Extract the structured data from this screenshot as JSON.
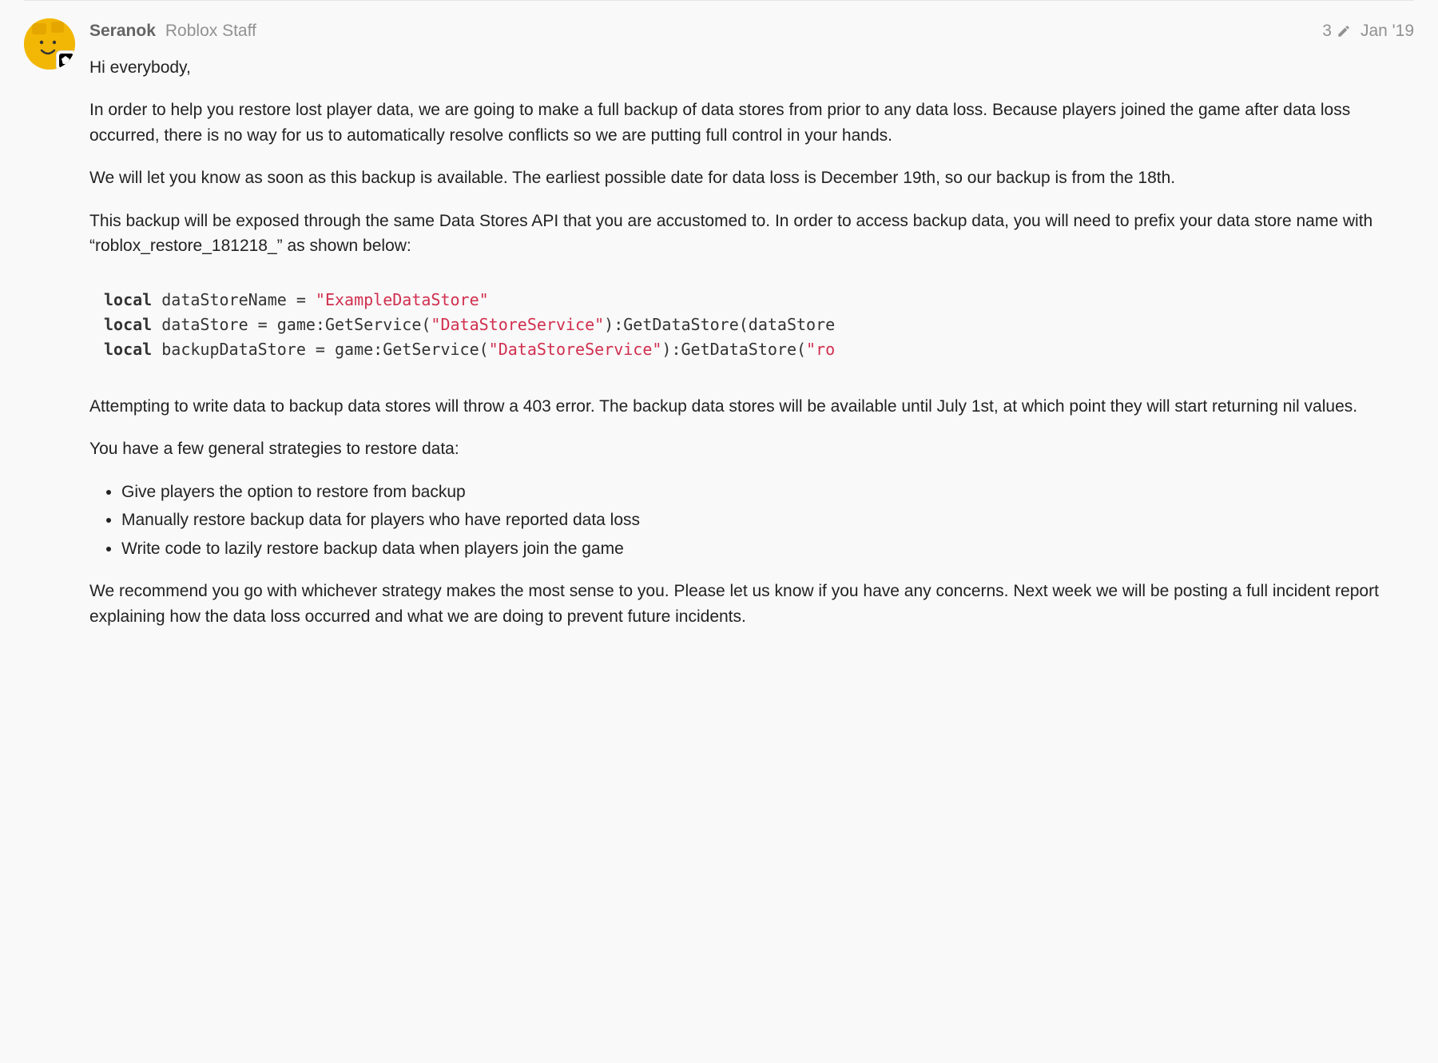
{
  "post": {
    "author": "Seranok",
    "role": "Roblox Staff",
    "edit_count": "3",
    "date": "Jan '19",
    "paragraphs": {
      "p1": "Hi everybody,",
      "p2": "In order to help you restore lost player data, we are going to make a full backup of data stores from prior to any data loss. Because players joined the game after data loss occurred, there is no way for us to automatically resolve conflicts so we are putting full control in your hands.",
      "p3": "We will let you know as soon as this backup is available. The earliest possible date for data loss is December 19th, so our backup is from the 18th.",
      "p4": "This backup will be exposed through the same Data Stores API that you are accustomed to. In order to access backup data, you will need to prefix your data store name with “roblox_restore_181218_” as shown below:",
      "p5": "Attempting to write data to backup data stores will throw a 403 error. The backup data stores will be available until July 1st, at which point they will start returning nil values.",
      "p6": "You have a few general strategies to restore data:",
      "p7": "We recommend you go with whichever strategy makes the most sense to you. Please let us know if you have any concerns. Next week we will be posting a full incident report explaining how the data loss occurred and what we are doing to prevent future incidents."
    },
    "code": {
      "kw_local": "local",
      "l1_ident": " dataStoreName = ",
      "l1_str": "\"ExampleDataStore\"",
      "l2_ident": " dataStore = game:GetService(",
      "l2_str": "\"DataStoreService\"",
      "l2_tail": "):GetDataStore(dataStore",
      "l3_ident": " backupDataStore = game:GetService(",
      "l3_str": "\"DataStoreService\"",
      "l3_tail": "):GetDataStore(",
      "l3_str2": "\"ro"
    },
    "strategies": [
      "Give players the option to restore from backup",
      "Manually restore backup data for players who have reported data loss",
      "Write code to lazily restore backup data when players join the game"
    ]
  }
}
